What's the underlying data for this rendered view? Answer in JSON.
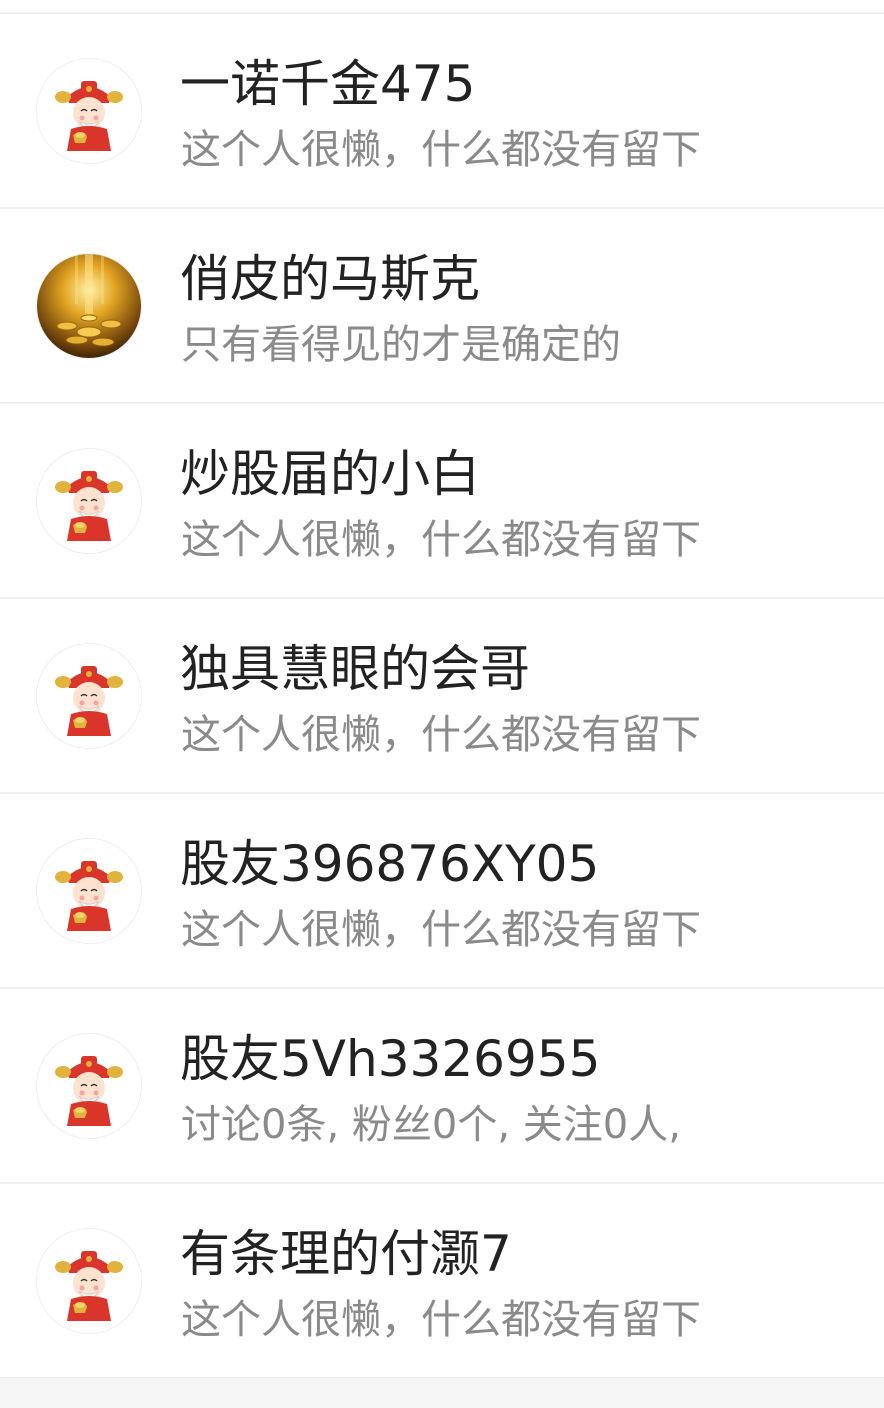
{
  "users": [
    {
      "name": "一诺千金475",
      "desc": "这个人很懒，什么都没有留下",
      "avatar": "caishen-avatar-icon"
    },
    {
      "name": "俏皮的马斯克",
      "desc": "只有看得见的才是确定的",
      "avatar": "gold-coins-avatar-icon"
    },
    {
      "name": "炒股届的小白",
      "desc": "这个人很懒，什么都没有留下",
      "avatar": "caishen-avatar-icon"
    },
    {
      "name": "独具慧眼的会哥",
      "desc": "这个人很懒，什么都没有留下",
      "avatar": "caishen-avatar-icon"
    },
    {
      "name": "股友396876XY05",
      "desc": "这个人很懒，什么都没有留下",
      "avatar": "caishen-avatar-icon"
    },
    {
      "name": "股友5Vh3326955",
      "desc": "讨论0条, 粉丝0个, 关注0人,",
      "avatar": "caishen-avatar-icon"
    },
    {
      "name": "有条理的付灏7",
      "desc": "这个人很懒，什么都没有留下",
      "avatar": "caishen-avatar-icon"
    }
  ],
  "colors": {
    "name_text": "#222222",
    "desc_text": "#8a8a8a",
    "divider": "#f0f0f0",
    "caishen_red": "#d9352b",
    "gold": "#e2b33c"
  }
}
